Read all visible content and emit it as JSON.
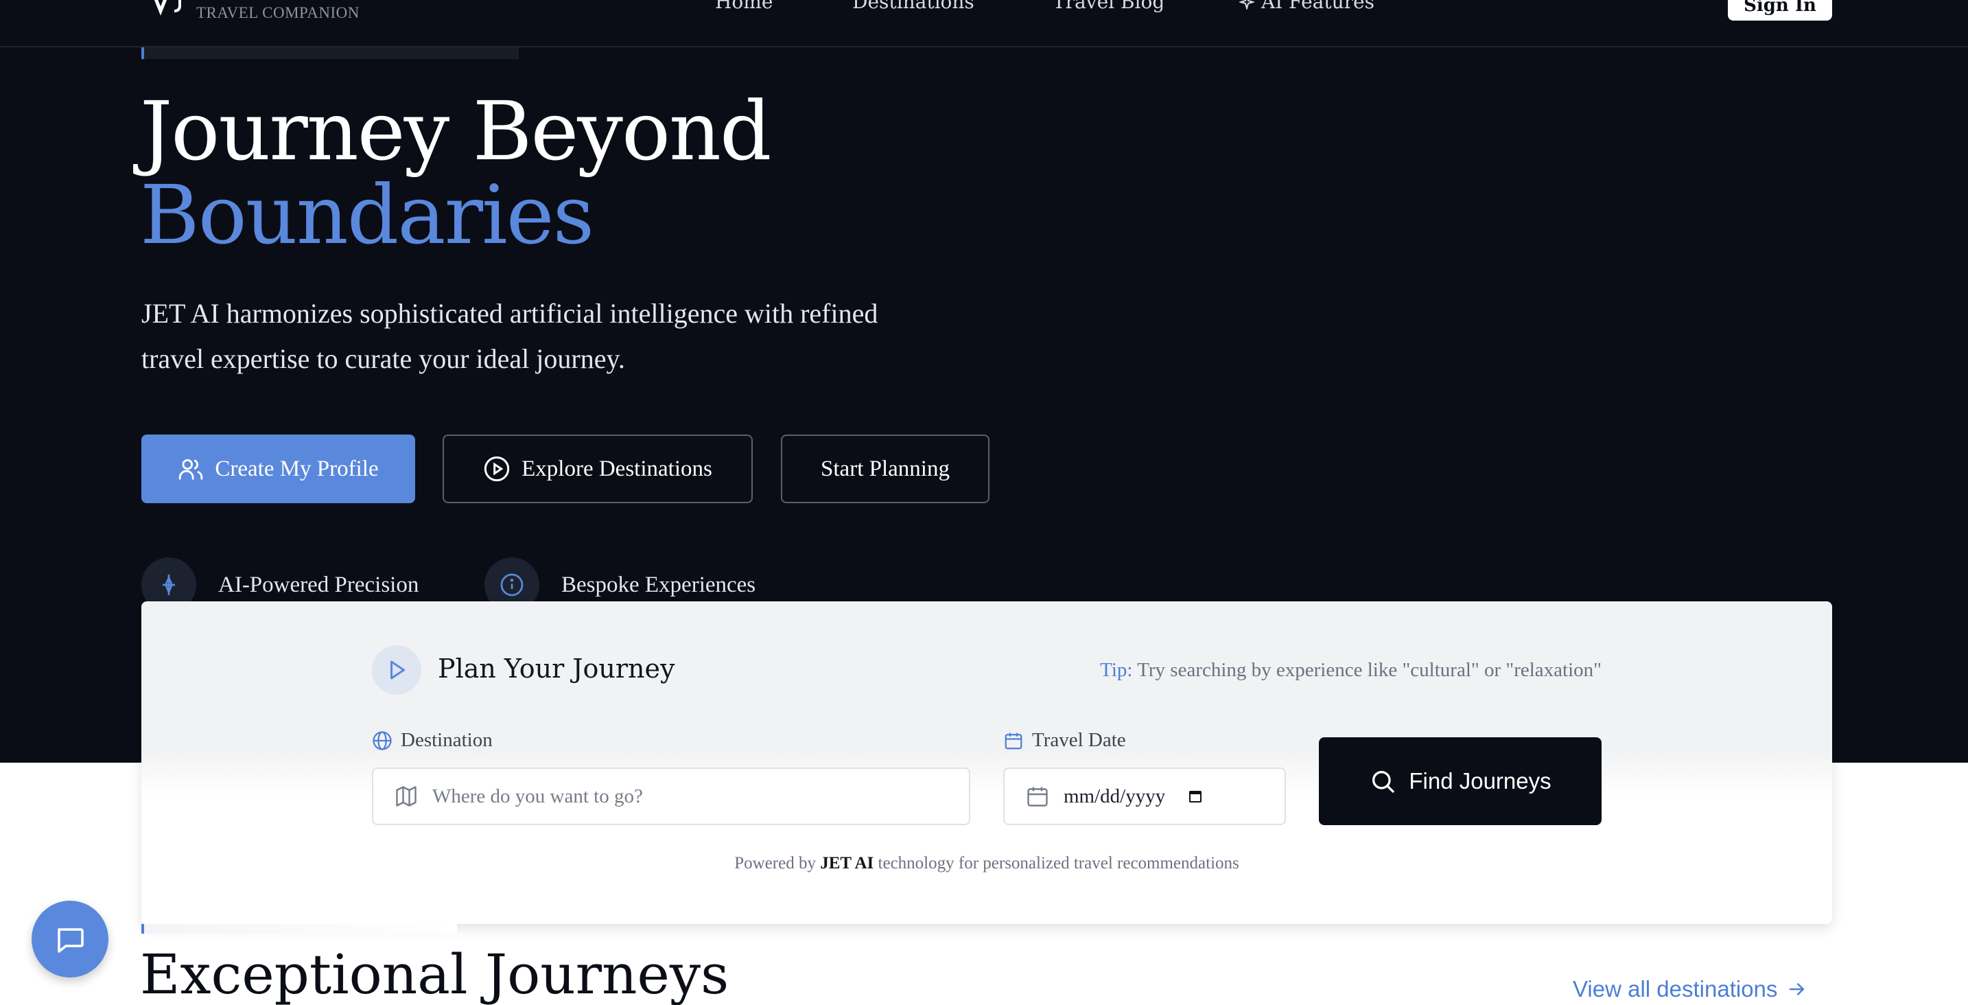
{
  "nav": {
    "logo_subtitle": "TRAVEL COMPANION",
    "links": [
      "Home",
      "Destinations",
      "Travel Blog",
      "AI Features"
    ],
    "sign_in": "Sign In"
  },
  "hero": {
    "title_line1": "Journey Beyond",
    "title_line2": "Boundaries",
    "subtitle": "JET AI harmonizes sophisticated artificial intelligence with refined travel expertise to curate your ideal journey.",
    "buttons": {
      "primary": "Create My Profile",
      "explore": "Explore Destinations",
      "plan": "Start Planning"
    },
    "features": [
      "AI-Powered Precision",
      "Bespoke Experiences"
    ]
  },
  "plan": {
    "title": "Plan Your Journey",
    "tip_label": "Tip:",
    "tip_text": "Try searching by experience like \"cultural\" or \"relaxation\"",
    "destination_label": "Destination",
    "destination_placeholder": "Where do you want to go?",
    "date_label": "Travel Date",
    "date_placeholder": "mm/dd/yyyy",
    "find_button": "Find Journeys",
    "powered_prefix": "Powered by",
    "powered_brand": "JET AI",
    "powered_suffix": "technology for personalized travel recommendations"
  },
  "section": {
    "title": "Exceptional Journeys",
    "view_all": "View all destinations"
  },
  "colors": {
    "hero_bg": "#0a0d16",
    "accent": "#5a88dc",
    "link": "#4d7ed6"
  },
  "icons": {
    "logo": "logo-mark-icon",
    "ai_features": "sparkle-icon",
    "profile": "users-icon",
    "explore": "play-circle-icon",
    "feature1": "compass-icon",
    "feature2": "info-icon",
    "plan": "play-icon",
    "destination": "globe-icon",
    "destination_input": "map-icon",
    "date": "calendar-icon",
    "find": "search-icon",
    "view_all": "arrow-right-icon",
    "chat": "chat-icon"
  }
}
